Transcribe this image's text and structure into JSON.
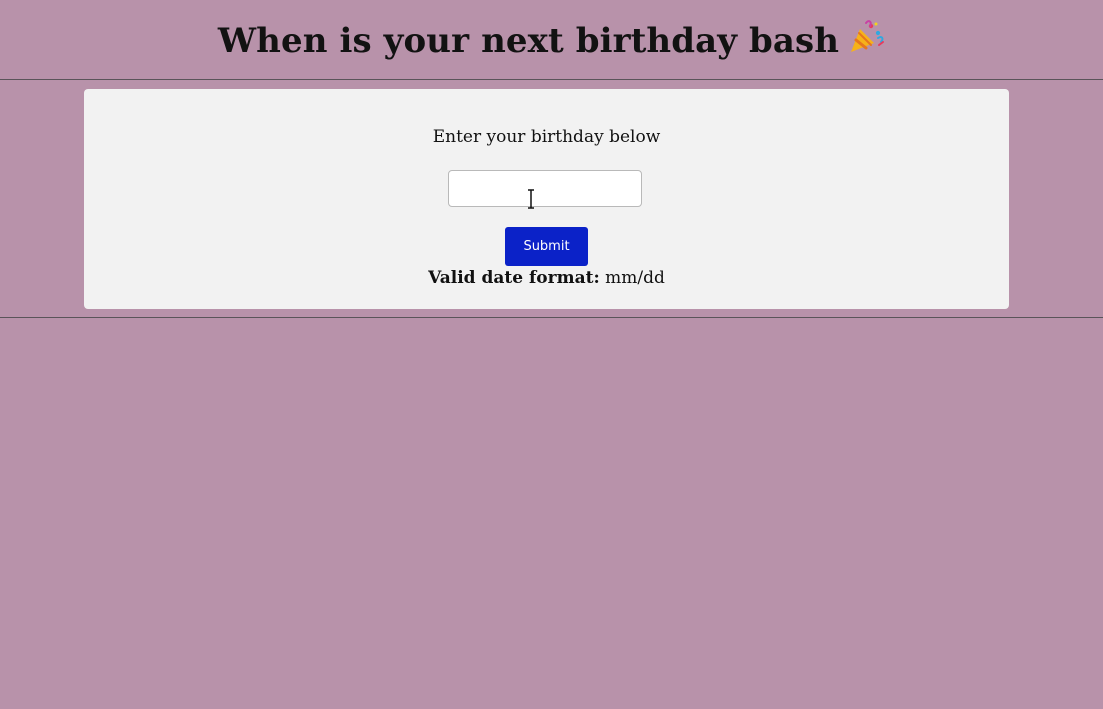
{
  "header": {
    "title": "When is your next birthday bash",
    "title_emoji_icon": "party-popper-icon"
  },
  "form": {
    "prompt": "Enter your birthday below",
    "birthday_input": {
      "value": "",
      "placeholder": ""
    },
    "submit_label": "Submit",
    "format_label": "Valid date format:",
    "format_value": "mm/dd"
  },
  "colors": {
    "page_background": "#b892aa",
    "card_background": "#f2f2f2",
    "button_background": "#0b22c8",
    "button_text": "#ffffff"
  }
}
